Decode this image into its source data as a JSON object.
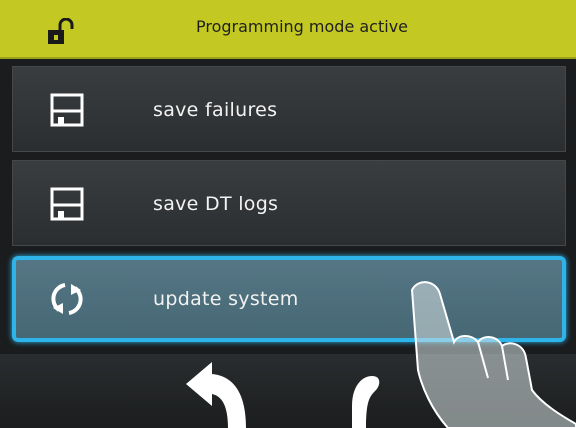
{
  "header": {
    "title": "Programming mode active",
    "icon": "unlocked-padlock-icon",
    "color": "#c3c922"
  },
  "menu": {
    "items": [
      {
        "label": "save failures",
        "icon": "floppy-disk-icon"
      },
      {
        "label": "save DT logs",
        "icon": "floppy-disk-icon"
      },
      {
        "label": "update system",
        "icon": "refresh-icon",
        "selected": true
      }
    ]
  },
  "footer": {
    "buttons": [
      {
        "icon": "back-arrow-icon"
      },
      {
        "icon": "home-icon"
      }
    ]
  },
  "colors": {
    "selection": "#2fb4ea",
    "row": "#2f3234",
    "selected_row": "#4f6f7c"
  }
}
